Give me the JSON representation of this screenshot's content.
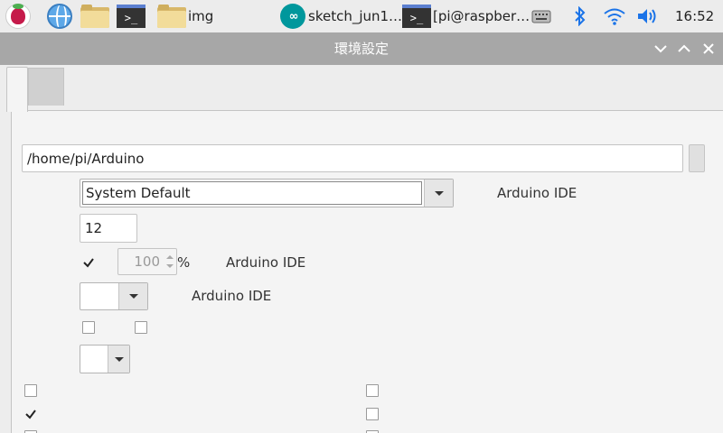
{
  "taskbar": {
    "items": [
      {
        "name": "raspberry-menu"
      },
      {
        "name": "web-browser"
      },
      {
        "name": "file-manager"
      },
      {
        "name": "terminal"
      },
      {
        "name": "img-folder",
        "label": "img"
      },
      {
        "name": "arduino-sketch",
        "label": "sketch_jun1…"
      },
      {
        "name": "terminal-window",
        "label": "[pi@raspber…"
      }
    ],
    "terminal_glyph": ">_",
    "clock": "16:52"
  },
  "window": {
    "title": "環境設定"
  },
  "preferences": {
    "sketchbook_path": "/home/pi/Arduino",
    "language_value": "System Default",
    "language_note": "Arduino IDE",
    "font_size": "12",
    "scale_value": "100",
    "scale_unit": "%",
    "scale_auto_checked": true,
    "scale_note": "Arduino IDE",
    "theme_note": "Arduino IDE",
    "left_checkboxes": [
      false,
      true,
      false
    ],
    "right_checkboxes": [
      false,
      false,
      false
    ]
  },
  "colors": {
    "titlebar": "#a7a7a7",
    "taskbar": "#ececec",
    "panel": "#f4f4f4",
    "accent": "#1a73e8"
  }
}
